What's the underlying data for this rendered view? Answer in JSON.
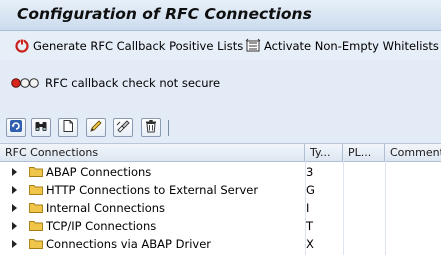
{
  "window": {
    "title": "Configuration of RFC Connections"
  },
  "app_toolbar": {
    "generate_label": "Generate RFC Callback Positive Lists",
    "activate_label": "Activate Non-Empty Whitelists"
  },
  "status": {
    "message": "RFC callback check not secure",
    "light_state": "red"
  },
  "alv_toolbar": {
    "icons": [
      "refresh-icon",
      "binoculars-icon",
      "display-icon",
      "edit-icon",
      "change-icon",
      "delete-icon"
    ]
  },
  "grid": {
    "columns": [
      {
        "label": "RFC Connections"
      },
      {
        "label": "Ty..."
      },
      {
        "label": "PL..."
      },
      {
        "label": "Comment"
      }
    ],
    "rows": [
      {
        "name": "ABAP Connections",
        "type": "3"
      },
      {
        "name": "HTTP Connections to External Server",
        "type": "G"
      },
      {
        "name": "Internal Connections",
        "type": "I"
      },
      {
        "name": "TCP/IP Connections",
        "type": "T"
      },
      {
        "name": "Connections via ABAP Driver",
        "type": "X"
      }
    ]
  },
  "colors": {
    "title_bg": "#cbdbee",
    "panel_bg": "#e3ecf6",
    "folder": "#f0c64a",
    "light_red": "#d9261c"
  }
}
